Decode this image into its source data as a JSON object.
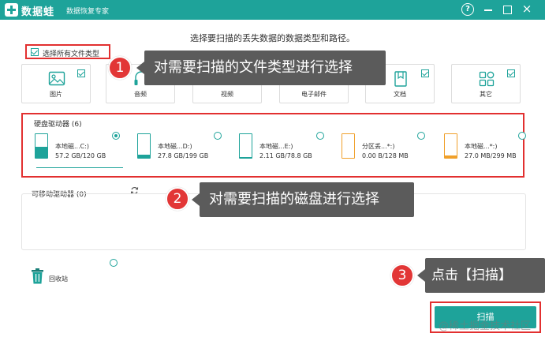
{
  "app": {
    "brand": "数据蛙",
    "subtitle": "数据恢复专家",
    "help_glyph": "?",
    "close_glyph": "×"
  },
  "instruction": "选择要扫描的丢失数据的数据类型和路径。",
  "select_all": {
    "label": "选择所有文件类型",
    "checked": true
  },
  "file_types": [
    {
      "label": "图片",
      "icon": "image-icon",
      "checked": true
    },
    {
      "label": "音频",
      "icon": "audio-icon",
      "checked": false
    },
    {
      "label": "视频",
      "icon": "video-icon",
      "checked": false
    },
    {
      "label": "电子邮件",
      "icon": "email-icon",
      "checked": false
    },
    {
      "label": "文档",
      "icon": "document-icon",
      "checked": true
    },
    {
      "label": "其它",
      "icon": "other-icon",
      "checked": true
    }
  ],
  "hard_drives": {
    "title": "硬盘驱动器 (6)",
    "drives": [
      {
        "name": "本地磁...C:)",
        "size": "57.2 GB/120 GB",
        "used_fraction": 0.48,
        "selected": true,
        "color": "#1ea39a"
      },
      {
        "name": "本地磁...D:)",
        "size": "27.8 GB/199 GB",
        "used_fraction": 0.14,
        "selected": false,
        "color": "#1ea39a"
      },
      {
        "name": "本地磁...E:)",
        "size": "2.11 GB/78.8 GB",
        "used_fraction": 0.03,
        "selected": false,
        "color": "#1ea39a"
      },
      {
        "name": "分区丢...*:)",
        "size": "0.00  B/128 MB",
        "used_fraction": 0.0,
        "selected": false,
        "color": "#f0a02a"
      },
      {
        "name": "本地磁...*:)",
        "size": "27.0 MB/299 MB",
        "used_fraction": 0.09,
        "selected": false,
        "color": "#f0a02a"
      }
    ]
  },
  "removable": {
    "title": "可移动驱动器 (0)"
  },
  "recycle_bin": {
    "label": "回收站"
  },
  "callouts": [
    {
      "number": "1",
      "text": "对需要扫描的文件类型进行选择"
    },
    {
      "number": "2",
      "text": "对需要扫描的磁盘进行选择"
    },
    {
      "number": "3",
      "text": "点击【扫描】"
    }
  ],
  "scan_button": {
    "label": "扫描"
  },
  "watermark": "@稀土掘金技术社区",
  "colors": {
    "accent": "#1ea39a",
    "highlight": "#e23030",
    "callout_bg": "#5b5b5b",
    "partition": "#f0a02a"
  }
}
